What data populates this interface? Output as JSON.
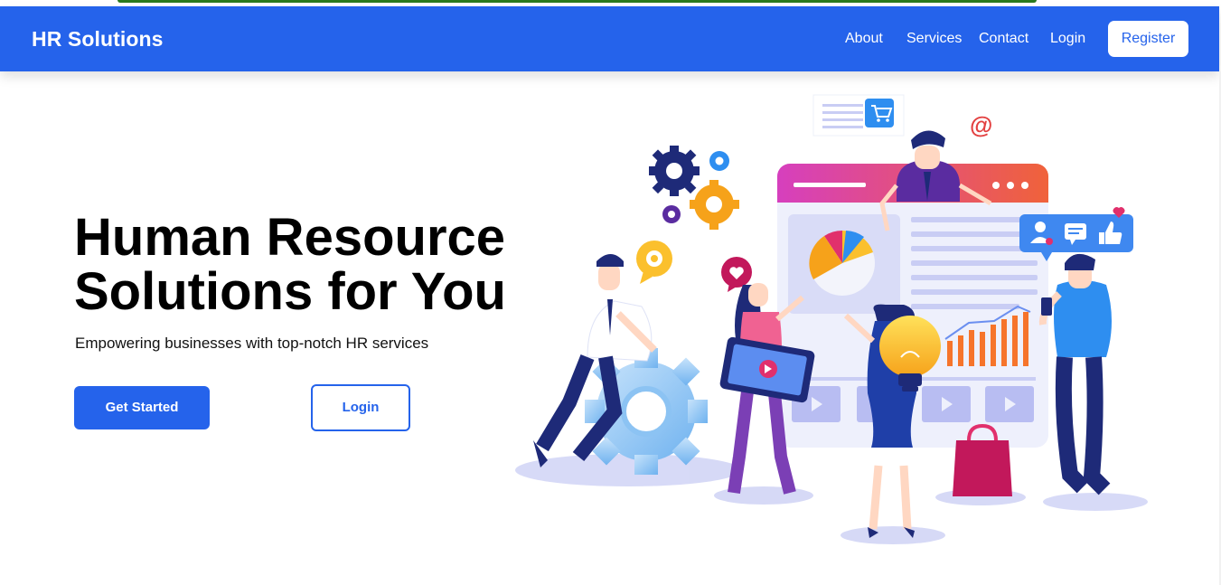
{
  "nav": {
    "brand": "HR Solutions",
    "links": [
      "About",
      "Services",
      "Contact",
      "Login"
    ],
    "register": "Register"
  },
  "hero": {
    "title_line1": "Human Resource",
    "title_line2": "Solutions for You",
    "subtitle": "Empowering businesses with top-notch HR services",
    "primary_button": "Get Started",
    "secondary_button": "Login"
  },
  "illustration": {
    "email_symbol": "@"
  },
  "colors": {
    "brand": "#2563eb",
    "dark_navy": "#1e2a78",
    "accent_orange": "#f6a21a",
    "accent_pink": "#e1306c"
  }
}
